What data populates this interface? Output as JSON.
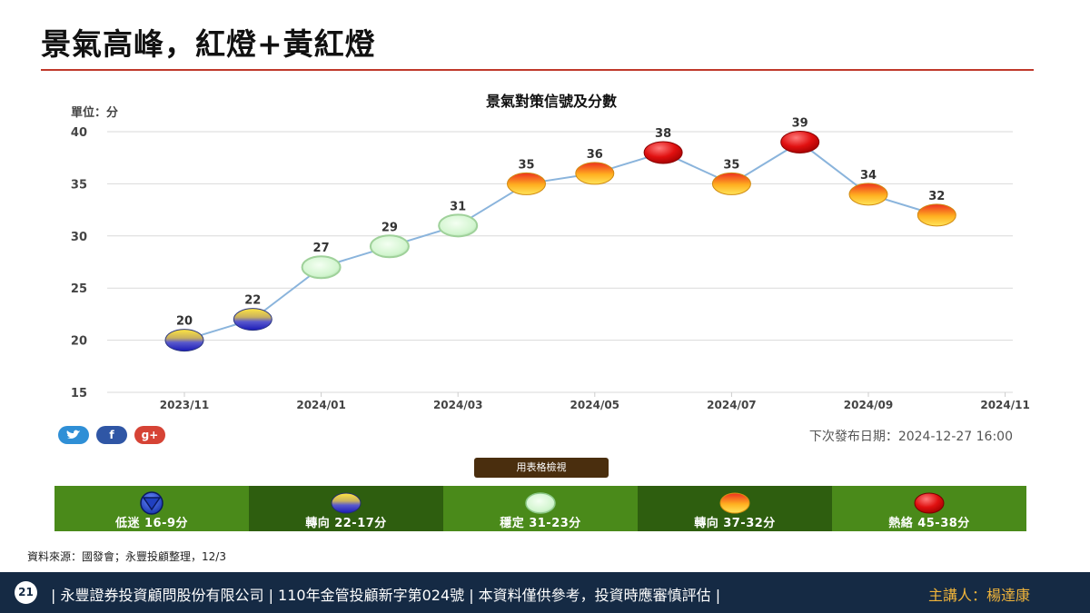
{
  "slide": {
    "title": "景氣高峰，紅燈+黃紅燈",
    "source_note": "資料來源：國發會；永豐投顧整理，12/3"
  },
  "chart_data": {
    "type": "line",
    "title": "景氣對策信號及分數",
    "unit_label": "單位：分",
    "x": [
      "2023/11",
      "2023/12",
      "2024/01",
      "2024/02",
      "2024/03",
      "2024/04",
      "2024/05",
      "2024/06",
      "2024/07",
      "2024/08",
      "2024/09",
      "2024/10"
    ],
    "x_tick_labels": [
      "2023/11",
      "2024/01",
      "2024/03",
      "2024/05",
      "2024/07",
      "2024/09",
      "2024/11"
    ],
    "series": [
      {
        "values": [
          20,
          22,
          27,
          29,
          31,
          35,
          36,
          38,
          35,
          39,
          34,
          32
        ],
        "signals": [
          "blue-yellow",
          "blue-yellow",
          "green",
          "green",
          "green",
          "yellow-red",
          "yellow-red",
          "red",
          "yellow-red",
          "red",
          "yellow-red",
          "yellow-red"
        ]
      }
    ],
    "y_ticks": [
      15,
      20,
      25,
      30,
      35,
      40
    ],
    "ylim": [
      15,
      40
    ],
    "grid": true,
    "line_color": "#8ab4dc"
  },
  "social": {
    "twitter": "twitter-icon",
    "facebook": "facebook-icon",
    "google_plus": "google-plus-icon",
    "facebook_glyph": "f",
    "google_plus_glyph": "g+"
  },
  "next_release": "下次發布日期：2024-12-27 16:00",
  "table_view_button": "用表格檢視",
  "legend": [
    {
      "signal": "blue",
      "label": "低迷 16-9分"
    },
    {
      "signal": "blue-yellow",
      "label": "轉向 22-17分"
    },
    {
      "signal": "green",
      "label": "穩定 31-23分"
    },
    {
      "signal": "yellow-red",
      "label": "轉向 37-32分"
    },
    {
      "signal": "red",
      "label": "熱絡 45-38分"
    }
  ],
  "footer": {
    "page_number": "21",
    "disclaimer": "| 永豐證券投資顧問股份有限公司 | 110年金管投顧新字第024號 | 本資料僅供參考，投資時應審慎評估 |",
    "speaker": "主講人：楊達康"
  },
  "colors": {
    "footer_bg": "#152a44",
    "speaker_text": "#f0b43a",
    "title_rule": "#c0392b",
    "legend_light": "#4a8a1a",
    "legend_dark": "#2e5e0f"
  }
}
